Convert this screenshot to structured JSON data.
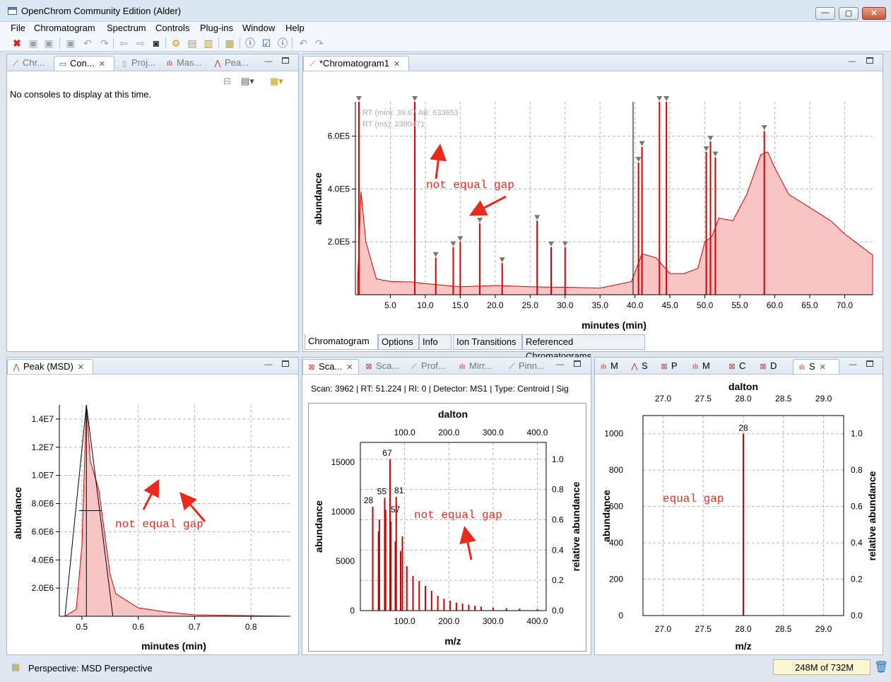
{
  "window": {
    "title": "OpenChrom Community Edition (Alder)",
    "controls": {
      "minimize": "—",
      "maximize": "▢",
      "close": "✕"
    }
  },
  "menubar": [
    "File",
    "Chromatogram",
    "Spectrum",
    "Controls",
    "Plug-ins",
    "Window",
    "Help"
  ],
  "toolbar": {
    "icons": [
      "close-red-icon",
      "save-icon",
      "save-all-icon",
      "save-as-icon",
      "undo-icon",
      "redo-icon",
      "back-icon",
      "forward-icon",
      "camera-icon",
      "process-icon",
      "import-icon",
      "export-icon",
      "report-icon",
      "info-icon",
      "checklist-icon",
      "help-icon",
      "undo-gray-icon",
      "redo-gray-icon"
    ]
  },
  "left_panel": {
    "tabs": [
      {
        "label": "Chr...",
        "icon": "chromatogram-icon"
      },
      {
        "label": "Con...",
        "icon": "console-icon",
        "active": true
      },
      {
        "label": "Proj...",
        "icon": "project-icon"
      },
      {
        "label": "Mas...",
        "icon": "mass-spectrum-icon"
      },
      {
        "label": "Pea...",
        "icon": "peak-icon"
      }
    ],
    "message": "No consoles to display at this time."
  },
  "chromatogram_panel": {
    "tab_label": "*Chromatogram1",
    "overlay_lines": [
      "RT (min): 39.67 AB: 633653",
      "RT (ms): 2380471"
    ],
    "annotation": "not equal gap",
    "bottom_tabs": [
      "Chromatogram",
      "Options",
      "Info",
      "Ion Transitions",
      "Referenced Chromatograms"
    ],
    "chart_data": {
      "type": "area",
      "xlabel": "minutes (min)",
      "ylabel": "abundance",
      "x_ticks": [
        "5.0",
        "10.0",
        "15.0",
        "20.0",
        "25.0",
        "30.0",
        "35.0",
        "40.0",
        "45.0",
        "50.0",
        "55.0",
        "60.0",
        "65.0",
        "70.0"
      ],
      "y_ticks": [
        "2.0E5",
        "4.0E5",
        "6.0E5"
      ],
      "xlim": [
        0,
        74
      ],
      "ylim": [
        0,
        730000
      ],
      "series_color": "#d40000",
      "baseline_points": [
        [
          0.3,
          40000
        ],
        [
          0.8,
          390000
        ],
        [
          1.5,
          200000
        ],
        [
          3,
          60000
        ],
        [
          5,
          50000
        ],
        [
          8,
          48000
        ],
        [
          10,
          42000
        ],
        [
          15,
          30000
        ],
        [
          20,
          35000
        ],
        [
          25,
          30000
        ],
        [
          30,
          28000
        ],
        [
          35,
          25000
        ],
        [
          39.5,
          50000
        ],
        [
          41,
          155000
        ],
        [
          43,
          140000
        ],
        [
          45,
          80000
        ],
        [
          47,
          80000
        ],
        [
          49,
          100000
        ],
        [
          50,
          200000
        ],
        [
          51,
          220000
        ],
        [
          52,
          290000
        ],
        [
          54,
          280000
        ],
        [
          56,
          380000
        ],
        [
          58,
          530000
        ],
        [
          59,
          540000
        ],
        [
          60,
          480000
        ],
        [
          62,
          380000
        ],
        [
          65,
          330000
        ],
        [
          68,
          280000
        ],
        [
          70,
          230000
        ],
        [
          72,
          190000
        ],
        [
          74,
          150000
        ]
      ],
      "spikes": [
        [
          0.5,
          730000
        ],
        [
          8.5,
          730000
        ],
        [
          11.5,
          140000
        ],
        [
          14,
          180000
        ],
        [
          15,
          200000
        ],
        [
          17.8,
          270000
        ],
        [
          21,
          120000
        ],
        [
          26,
          280000
        ],
        [
          28,
          180000
        ],
        [
          30,
          180000
        ],
        [
          40.5,
          500000
        ],
        [
          41,
          560000
        ],
        [
          43.5,
          730000
        ],
        [
          44.5,
          730000
        ],
        [
          50.2,
          540000
        ],
        [
          50.8,
          580000
        ],
        [
          51.5,
          520000
        ],
        [
          58.5,
          620000
        ]
      ]
    }
  },
  "peak_panel": {
    "tab_label": "Peak (MSD)",
    "annotation": "not equal gap",
    "chart_data": {
      "type": "area",
      "xlabel": "minutes (min)",
      "ylabel": "abundance",
      "x_ticks": [
        "0.5",
        "0.6",
        "0.7",
        "0.8"
      ],
      "y_ticks": [
        "2.0E6",
        "4.0E6",
        "6.0E6",
        "8.0E6",
        "1.0E7",
        "1.2E7",
        "1.4E7"
      ],
      "xlim": [
        0.46,
        0.87
      ],
      "ylim": [
        0,
        15000000
      ],
      "outline": [
        [
          0.47,
          0
        ],
        [
          0.49,
          500000
        ],
        [
          0.5,
          5000000
        ],
        [
          0.508,
          15000000
        ],
        [
          0.515,
          11000000
        ],
        [
          0.53,
          9000000
        ],
        [
          0.55,
          3000000
        ],
        [
          0.56,
          1600000
        ],
        [
          0.6,
          600000
        ],
        [
          0.65,
          300000
        ],
        [
          0.7,
          100000
        ],
        [
          0.87,
          0
        ]
      ],
      "triangle": [
        [
          0.47,
          0
        ],
        [
          0.508,
          15000000
        ],
        [
          0.555,
          0
        ]
      ]
    }
  },
  "scan_panel": {
    "tabs": [
      {
        "label": "Sca...",
        "icon": "scan-icon",
        "active": true
      },
      {
        "label": "Sca...",
        "icon": "scan-icon"
      },
      {
        "label": "Prof...",
        "icon": "profile-icon"
      },
      {
        "label": "Mirr...",
        "icon": "mirror-icon"
      },
      {
        "label": "Pinn...",
        "icon": "pin-icon"
      }
    ],
    "info_line": "Scan: 3962 | RT: 51.224 | RI: 0 | Detector: MS1 | Type: Centroid | Sig",
    "annotation": "not equal gap",
    "chart_data": {
      "type": "bar",
      "top_axis_label": "dalton",
      "xlabel": "m/z",
      "ylabel": "abundance",
      "y2label": "relative abundance",
      "top_ticks": [
        "100.0",
        "200.0",
        "300.0",
        "400.0"
      ],
      "x_ticks": [
        "100.0",
        "200.0",
        "300.0",
        "400.0"
      ],
      "y_ticks": [
        "0",
        "5000",
        "10000",
        "15000"
      ],
      "y2_ticks": [
        "0.0",
        "0.2",
        "0.4",
        "0.6",
        "0.8",
        "1.0"
      ],
      "xlim": [
        0,
        420
      ],
      "ylim": [
        0,
        17000
      ],
      "peak_labels": [
        "28",
        "55",
        "57",
        "67",
        "81"
      ],
      "peaks": [
        [
          28,
          10500
        ],
        [
          41,
          8000
        ],
        [
          43,
          9200
        ],
        [
          55,
          11400
        ],
        [
          57,
          10200
        ],
        [
          67,
          15300
        ],
        [
          69,
          9000
        ],
        [
          79,
          7000
        ],
        [
          81,
          11500
        ],
        [
          91,
          6000
        ],
        [
          95,
          7500
        ],
        [
          105,
          4500
        ],
        [
          119,
          3500
        ],
        [
          133,
          3000
        ],
        [
          147,
          2500
        ],
        [
          161,
          2000
        ],
        [
          175,
          1500
        ],
        [
          189,
          1200
        ],
        [
          203,
          1000
        ],
        [
          217,
          800
        ],
        [
          231,
          700
        ],
        [
          245,
          600
        ],
        [
          259,
          500
        ],
        [
          273,
          400
        ],
        [
          300,
          300
        ],
        [
          330,
          250
        ],
        [
          360,
          200
        ],
        [
          400,
          150
        ]
      ]
    }
  },
  "right_panel": {
    "tabs": [
      {
        "label": "M",
        "icon": "mass-icon"
      },
      {
        "label": "S",
        "icon": "spectrum-icon"
      },
      {
        "label": "P",
        "icon": "peak-list-icon"
      },
      {
        "label": "M",
        "icon": "mass-icon"
      },
      {
        "label": "C",
        "icon": "compare-icon"
      },
      {
        "label": "D",
        "icon": "difference-icon"
      },
      {
        "label": "S",
        "icon": "spectrum-icon",
        "active": true
      }
    ],
    "annotation": "equal gap",
    "chart_data": {
      "type": "bar",
      "top_axis_label": "dalton",
      "xlabel": "m/z",
      "ylabel": "abundance",
      "y2label": "relative abundance",
      "top_ticks": [
        "27.0",
        "27.5",
        "28.0",
        "28.5",
        "29.0"
      ],
      "x_ticks": [
        "27.0",
        "27.5",
        "28.0",
        "28.5",
        "29.0"
      ],
      "y_ticks": [
        "0",
        "200",
        "400",
        "600",
        "800",
        "1000"
      ],
      "y2_ticks": [
        "0.0",
        "0.2",
        "0.4",
        "0.6",
        "0.8",
        "1.0"
      ],
      "xlim": [
        26.75,
        29.25
      ],
      "ylim": [
        0,
        1100
      ],
      "bar": {
        "x": 28.0,
        "value": 1000,
        "label": "28"
      }
    }
  },
  "statusbar": {
    "perspective": "Perspective: MSD Perspective",
    "memory": "248M of 732M"
  }
}
